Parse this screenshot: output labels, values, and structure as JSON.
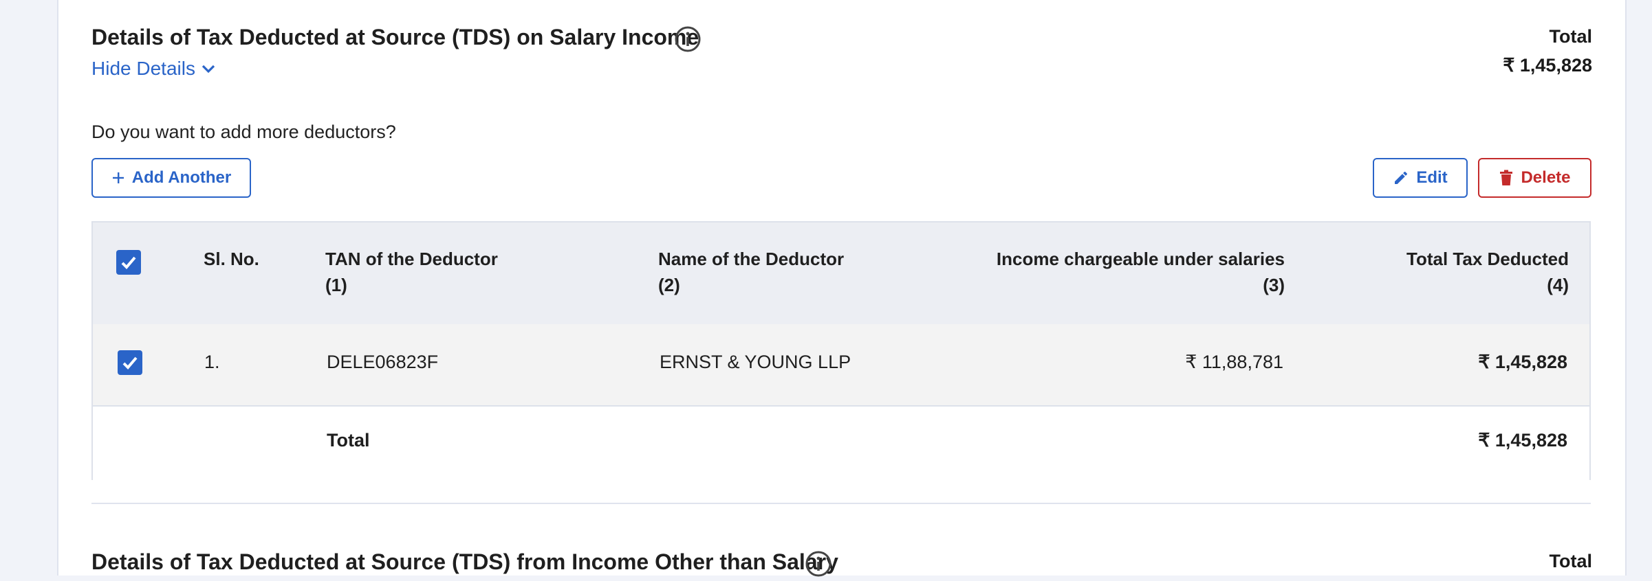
{
  "section1": {
    "title": "Details of Tax Deducted at Source (TDS) on Salary Income",
    "hide_details": "Hide Details",
    "total_label": "Total",
    "total_value": "₹ 1,45,828",
    "question": "Do you want to add more deductors?",
    "add_another": "Add Another",
    "edit": "Edit",
    "delete": "Delete",
    "table": {
      "headers": {
        "sl_no": "Sl. No.",
        "tan_line1": "TAN of the Deductor",
        "tan_line2": "(1)",
        "name_line1": "Name of the Deductor",
        "name_line2": "(2)",
        "income_line1": "Income chargeable under salaries",
        "income_line2": "(3)",
        "tax_line1": "Total Tax Deducted",
        "tax_line2": "(4)"
      },
      "rows": [
        {
          "checked": true,
          "sl_no": "1.",
          "tan": "DELE06823F",
          "name": "ERNST & YOUNG LLP",
          "income": "₹ 11,88,781",
          "tax": "₹ 1,45,828"
        }
      ],
      "footer": {
        "label": "Total",
        "value": "₹ 1,45,828"
      }
    }
  },
  "section2": {
    "title": "Details of Tax Deducted at Source (TDS) from Income Other than Salary",
    "total_label": "Total"
  },
  "colors": {
    "accent": "#2a64c8",
    "danger": "#c42b2b",
    "header_bg": "#eceef3",
    "page_bg": "#f1f3f9"
  }
}
